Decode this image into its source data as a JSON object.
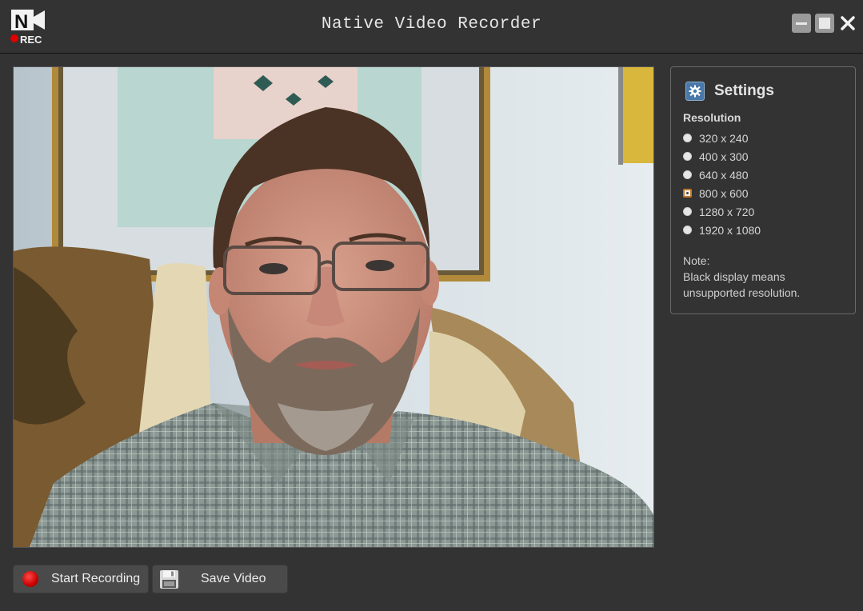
{
  "window": {
    "title": "Native Video Recorder",
    "logo_letter": "N",
    "logo_badge": "REC"
  },
  "settings": {
    "title": "Settings",
    "resolution_label": "Resolution",
    "options": [
      {
        "label": "320 x 240",
        "selected": false
      },
      {
        "label": "400 x 300",
        "selected": false
      },
      {
        "label": "640 x 480",
        "selected": false
      },
      {
        "label": "800 x 600",
        "selected": true
      },
      {
        "label": "1280 x 720",
        "selected": false
      },
      {
        "label": "1920 x 1080",
        "selected": false
      }
    ],
    "note_title": "Note:",
    "note_line1": "Black display means",
    "note_line2": "unsupported resolution."
  },
  "buttons": {
    "record_label": "Start Recording",
    "save_label": "Save Video"
  },
  "colors": {
    "background": "#333333",
    "accent_red": "#c80000",
    "selection_orange": "#c6792a",
    "gear_blue": "#4a78a8"
  }
}
